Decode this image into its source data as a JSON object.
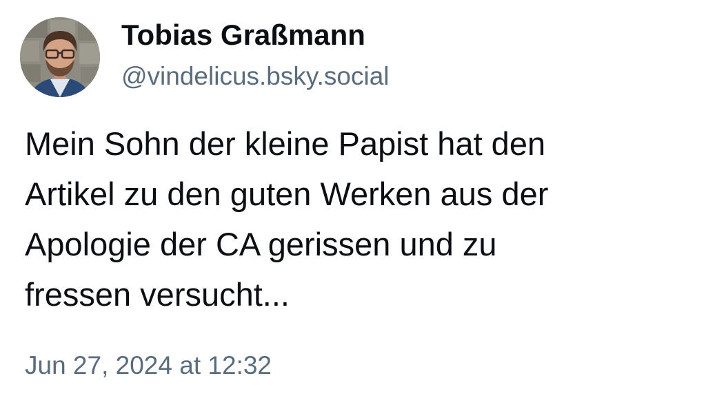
{
  "author": {
    "display_name": "Tobias Graßmann",
    "handle": "@vindelicus.bsky.social"
  },
  "post": {
    "text_lines": [
      "Mein Sohn der kleine Papist hat den",
      "Artikel zu den guten Werken aus der",
      "Apologie der CA gerissen und zu",
      "fressen versucht..."
    ],
    "timestamp": "Jun 27, 2024 at 12:32"
  },
  "colors": {
    "text_primary": "#0b0f14",
    "text_secondary": "#5a6b7e",
    "background": "#ffffff"
  }
}
